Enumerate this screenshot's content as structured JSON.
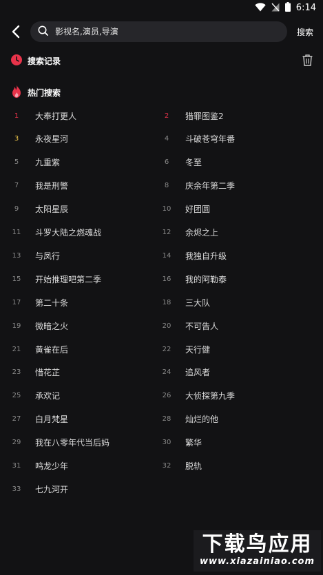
{
  "status_bar": {
    "time": "6:14"
  },
  "search": {
    "placeholder": "影视名,演员,导演",
    "submit_label": "搜索"
  },
  "history": {
    "title": "搜索记录"
  },
  "hot": {
    "title": "热门搜索",
    "rank_colors": {
      "1": "#e8334a",
      "2": "#e8334a",
      "3": "#f2c94c",
      "default": "#8a8a8a"
    },
    "items": [
      {
        "rank": "1",
        "title": "大奉打更人"
      },
      {
        "rank": "2",
        "title": "猎罪图鉴2"
      },
      {
        "rank": "3",
        "title": "永夜星河"
      },
      {
        "rank": "4",
        "title": "斗破苍穹年番"
      },
      {
        "rank": "5",
        "title": "九重紫"
      },
      {
        "rank": "6",
        "title": "冬至"
      },
      {
        "rank": "7",
        "title": "我是刑警"
      },
      {
        "rank": "8",
        "title": "庆余年第二季"
      },
      {
        "rank": "9",
        "title": "太阳星辰"
      },
      {
        "rank": "10",
        "title": "好团圆"
      },
      {
        "rank": "11",
        "title": "斗罗大陆之燃魂战"
      },
      {
        "rank": "12",
        "title": "余烬之上"
      },
      {
        "rank": "13",
        "title": "与凤行"
      },
      {
        "rank": "14",
        "title": "我独自升级"
      },
      {
        "rank": "15",
        "title": "开始推理吧第二季"
      },
      {
        "rank": "16",
        "title": "我的阿勒泰"
      },
      {
        "rank": "17",
        "title": "第二十条"
      },
      {
        "rank": "18",
        "title": "三大队"
      },
      {
        "rank": "19",
        "title": "微暗之火"
      },
      {
        "rank": "20",
        "title": "不可告人"
      },
      {
        "rank": "21",
        "title": "黄雀在后"
      },
      {
        "rank": "22",
        "title": "天行健"
      },
      {
        "rank": "23",
        "title": "惜花芷"
      },
      {
        "rank": "24",
        "title": "追风者"
      },
      {
        "rank": "25",
        "title": "承欢记"
      },
      {
        "rank": "26",
        "title": "大侦探第九季"
      },
      {
        "rank": "27",
        "title": "白月梵星"
      },
      {
        "rank": "28",
        "title": "灿烂的他"
      },
      {
        "rank": "29",
        "title": "我在八零年代当后妈"
      },
      {
        "rank": "30",
        "title": "繁华"
      },
      {
        "rank": "31",
        "title": "鸣龙少年"
      },
      {
        "rank": "32",
        "title": "脱轨"
      },
      {
        "rank": "33",
        "title": "七九河开"
      }
    ]
  },
  "watermark": {
    "cn": "下载鸟应用",
    "en": "www.xiazainiao.com"
  }
}
